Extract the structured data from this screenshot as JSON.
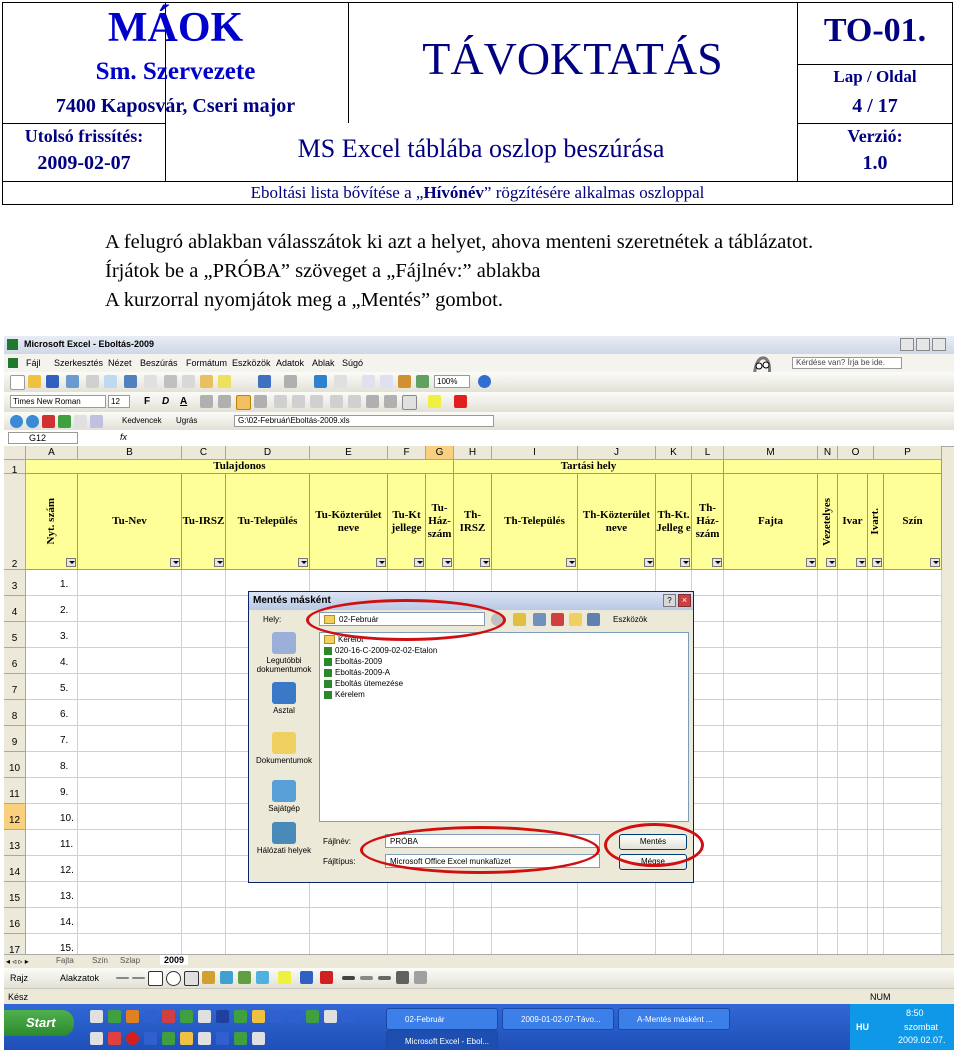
{
  "header": {
    "org_name": "MÁOK",
    "org_sub": "Sm. Szervezete",
    "address": "7400 Kaposvár, Cseri major",
    "doc_type": "TÁVOKTATÁS",
    "doc_code": "TO-01.",
    "page_label": "Lap / Oldal",
    "page_value": "4 / 17",
    "update_label": "Utolsó frissítés:",
    "update_value": "2009-02-07",
    "subject": "MS Excel táblába oszlop beszúrása",
    "version_label": "Verzió:",
    "version_value": "1.0",
    "subtitle_prefix": "Eboltási lista bővítése a „",
    "subtitle_bold": "Hívónév",
    "subtitle_suffix": "” rögzítésére alkalmas oszloppal"
  },
  "instructions": {
    "line1": "A felugró ablakban válasszátok ki azt a helyet, ahova menteni szeretnétek a táblázatot.",
    "line2": "Írjátok be a „PRÓBA” szöveget a „Fájlnév:” ablakba",
    "line3": "A kurzorral nyomjátok meg a „Mentés” gombot."
  },
  "excel": {
    "title": "Microsoft Excel - Eboltás-2009",
    "help_box": "Kérdése van? Írja be ide.",
    "menu": [
      "Fájl",
      "Szerkesztés",
      "Nézet",
      "Beszúrás",
      "Formátum",
      "Eszközök",
      "Adatok",
      "Ablak",
      "Súgó"
    ],
    "zoom": "100%",
    "font_name": "Times New Roman",
    "font_size": "12",
    "web_bar": {
      "favorites": "Kedvencek",
      "goto": "Ugrás",
      "path": "G:\\02-Február\\Eboltás-2009.xls"
    },
    "name_box": "G12",
    "fx": "fx",
    "columns": [
      "A",
      "B",
      "C",
      "D",
      "E",
      "F",
      "G",
      "H",
      "I",
      "J",
      "K",
      "L",
      "M",
      "N",
      "O",
      "P"
    ],
    "group1": "Tulajdonos",
    "group2": "Tartási hely",
    "headers": [
      "Nyt. szám",
      "Tu-Nev",
      "Tu-IRSZ",
      "Tu-Település",
      "Tu-Közterület neve",
      "Tu-Kt jellege",
      "Tu-Ház-szám",
      "Th-IRSZ",
      "Th-Település",
      "Th-Közterület neve",
      "Th-Kt. Jelleg e",
      "Th-Ház-szám",
      "Fajta",
      "Vezetelyes",
      "Ivar",
      "Ivart.",
      "Szín"
    ],
    "row_numbers": [
      "1",
      "2",
      "3",
      "4",
      "5",
      "6",
      "7",
      "8",
      "9",
      "10",
      "11",
      "12",
      "13",
      "14",
      "15",
      "16",
      "17"
    ],
    "values": [
      "1.",
      "2.",
      "3.",
      "4.",
      "5.",
      "6.",
      "7.",
      "8.",
      "9.",
      "10.",
      "11.",
      "12.",
      "13.",
      "14.",
      "15."
    ],
    "sheet_tabs": [
      "Fajta",
      "Szín",
      "Szlap",
      "2009"
    ],
    "draw_bar": {
      "rajz": "Rajz",
      "alakzatok": "Alakzatok"
    },
    "status": {
      "left": "Kész",
      "right": "NUM"
    }
  },
  "dialog": {
    "title": "Mentés másként",
    "location_label": "Hely:",
    "location_value": "02-Február",
    "tools": "Eszközök",
    "places": [
      "Legutóbbi dokumentumok",
      "Asztal",
      "Dokumentumok",
      "Sajátgép",
      "Hálózati helyek"
    ],
    "files": [
      "Kérelot",
      "020-16-C-2009-02-02-Etalon",
      "Eboltás-2009",
      "Eboltás-2009-A",
      "Eboltás ütemezése",
      "Kérelem"
    ],
    "filename_label": "Fájlnév:",
    "filename_value": "PRÓBA",
    "filetype_label": "Fájltípus:",
    "filetype_value": "Microsoft Office Excel munkafüzet",
    "save_button": "Mentés",
    "cancel_button": "Mégse"
  },
  "taskbar": {
    "start": "Start",
    "windows": [
      "02-Február",
      "2009-01-02-07-Távo...",
      "A-Mentés másként ...",
      "Microsoft Excel - Ebol..."
    ],
    "lang": "HU",
    "time": "8:50",
    "day": "szombat",
    "date": "2009.02.07."
  },
  "colors": {
    "org_blue": "#0000cc",
    "navy": "#000080",
    "header_yellow": "#ffff99",
    "highlight_red": "#d01010",
    "taskbar_blue": "#1f4fb8"
  }
}
